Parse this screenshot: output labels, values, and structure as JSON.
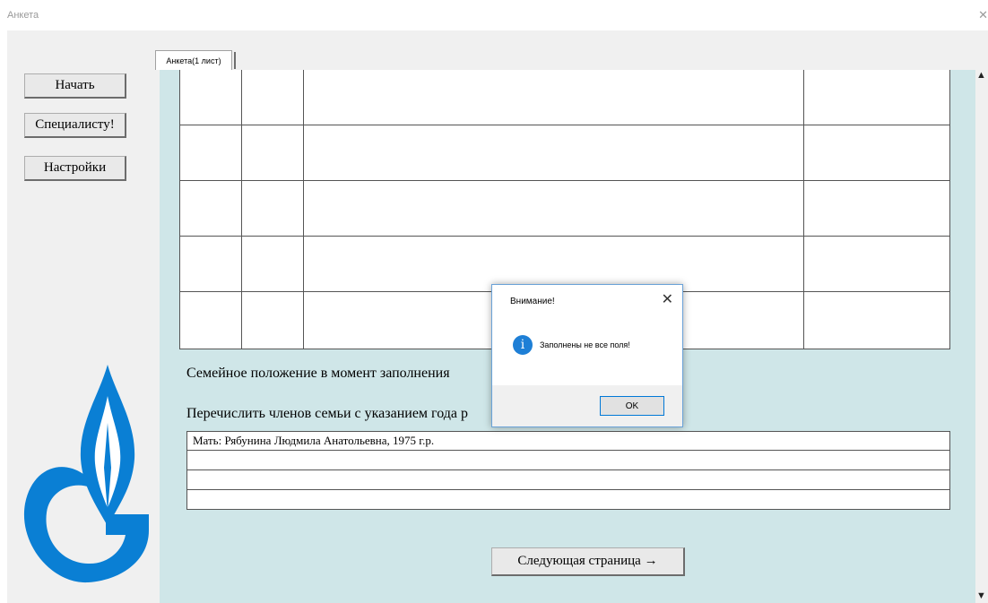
{
  "window": {
    "title": "Анкета",
    "close_glyph": "✕"
  },
  "sidebar": {
    "buttons": [
      {
        "label": "Начать"
      },
      {
        "label": "Специалисту!"
      },
      {
        "label": "Настройки"
      }
    ]
  },
  "logo": {
    "icon": "gazprom-flame-logo",
    "color": "#0a7fd4"
  },
  "tab": {
    "label": "Анкета(1 лист)"
  },
  "form": {
    "marital_label": "Семейное положение в момент заполнения",
    "family_label": "Перечислить членов семьи с указанием года р",
    "family_rows": [
      "Мать: Рябунина Людмила Анатольевна, 1975 г.р.",
      "",
      "",
      ""
    ],
    "next_button": "Следующая страница →"
  },
  "dialog": {
    "title": "Внимание!",
    "message": "Заполнены не все поля!",
    "ok": "OK",
    "close_glyph": "✕",
    "icon": "info-icon"
  },
  "colors": {
    "panel_bg": "#cfe6e8",
    "accent": "#0078d7"
  }
}
